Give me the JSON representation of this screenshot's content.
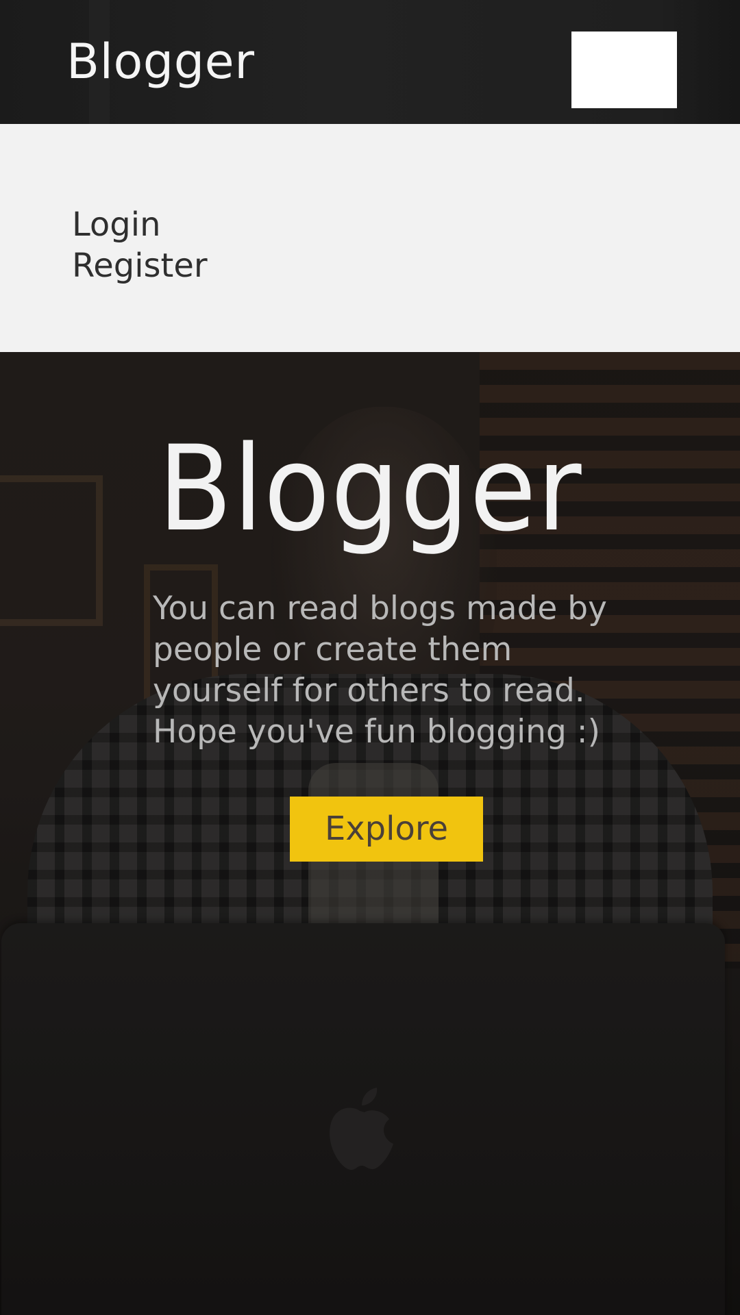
{
  "header": {
    "brand": "Blogger"
  },
  "nav": {
    "items": [
      {
        "label": "Login"
      },
      {
        "label": "Register"
      }
    ]
  },
  "hero": {
    "title": "Blogger",
    "description": "You can read blogs made by people or create them yourself for others to read. Hope you've fun blogging :)",
    "cta_label": "Explore"
  },
  "colors": {
    "header_bg": "#1e1e1e",
    "nav_bg": "#f2f2f2",
    "accent": "#f1c40f",
    "hero_title": "#f2f2f2",
    "hero_text": "#b8b8b8"
  },
  "icons": {
    "menu_toggle": "menu-toggle-icon",
    "laptop_logo": "apple-icon"
  }
}
